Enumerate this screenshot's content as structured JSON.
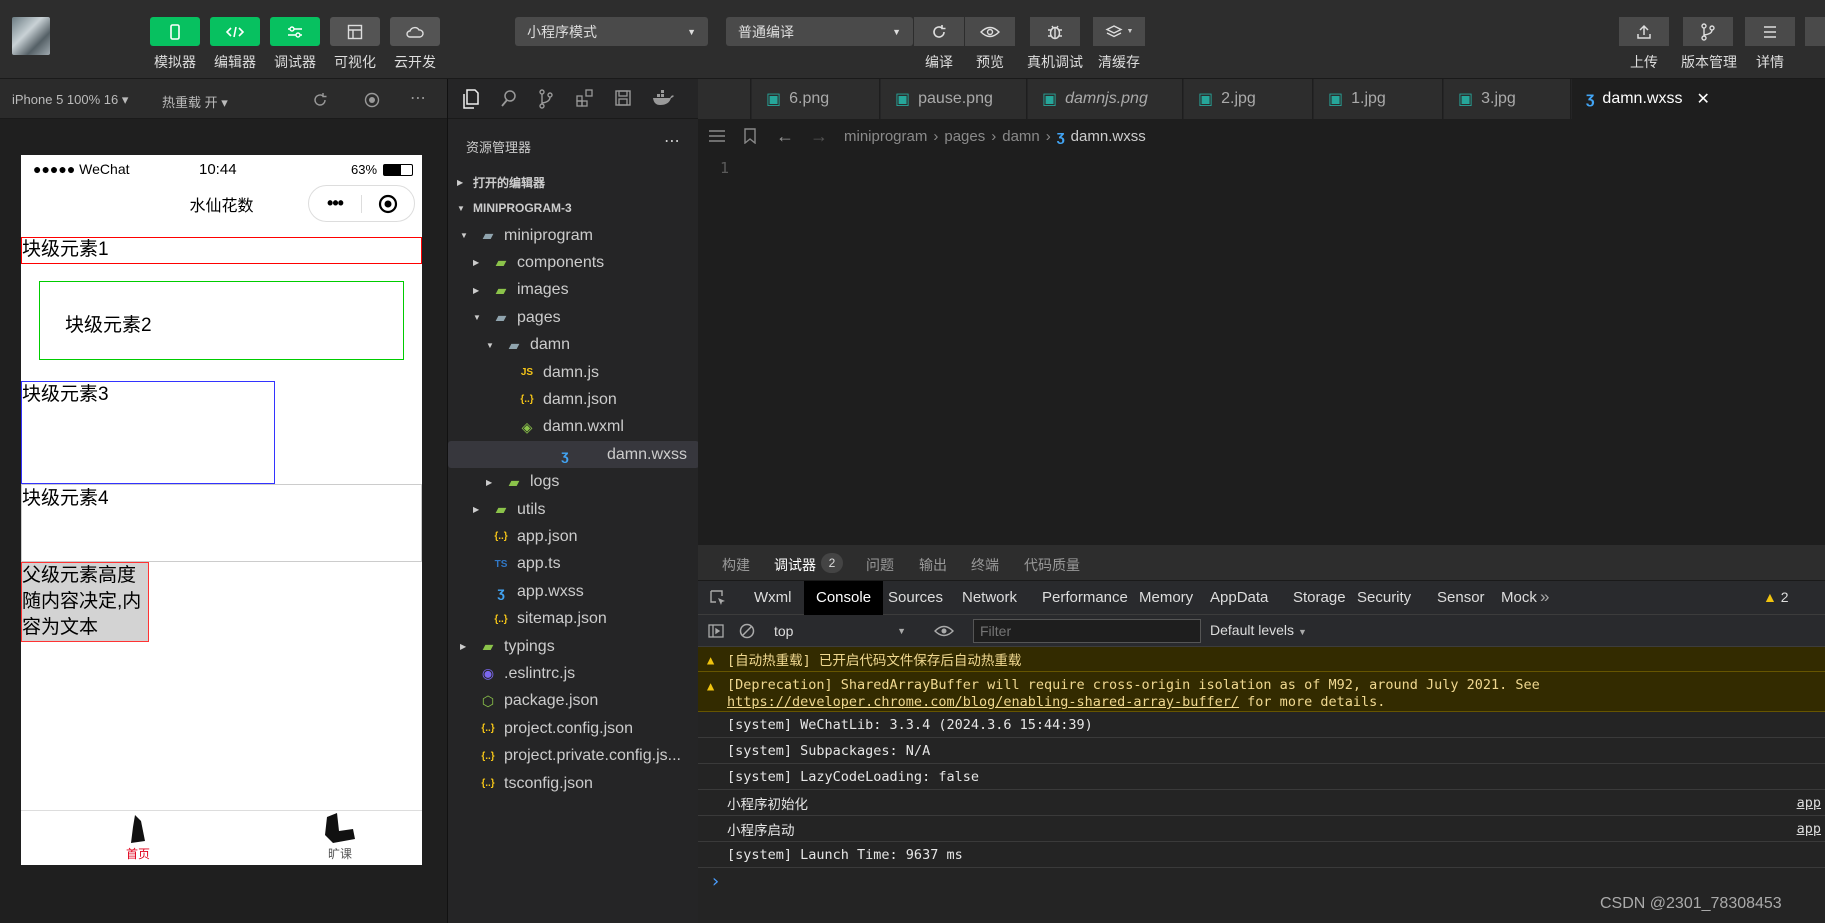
{
  "toolbar": {
    "buttons": [
      {
        "label": "模拟器",
        "icon": "phone-icon"
      },
      {
        "label": "编辑器",
        "icon": "code-icon"
      },
      {
        "label": "调试器",
        "icon": "debug-icon"
      },
      {
        "label": "可视化",
        "icon": "layout-icon"
      },
      {
        "label": "云开发",
        "icon": "cloud-icon"
      }
    ],
    "mode_select": "小程序模式",
    "compile_select": "普通编译",
    "actions": [
      "编译",
      "预览",
      "真机调试",
      "清缓存"
    ],
    "right": [
      "上传",
      "版本管理",
      "详情"
    ]
  },
  "sim": {
    "device": "iPhone 5 100% 16",
    "hotreload": "热重载 开",
    "status_carrier": "●●●●● WeChat",
    "status_time": "10:44",
    "status_battery": "63%",
    "nav_title": "水仙花数",
    "blocks": [
      "块级元素1",
      "块级元素2",
      "块级元素3",
      "块级元素4"
    ],
    "parent_block": "父级元素高度随内容决定,内容为文本",
    "tabbar": [
      "首页",
      "旷课"
    ],
    "colors": {
      "block1": "#ff0000",
      "block2": "#00cc00",
      "block3": "#3333ff",
      "parent": "#ff3333",
      "parent_bg": "#d3d3d3"
    }
  },
  "explorer": {
    "title": "资源管理器",
    "open_editors": "打开的编辑器",
    "project": "MINIPROGRAM-3",
    "tree": [
      {
        "name": "miniprogram",
        "icon": "folder-open-icon",
        "level": 1,
        "arrow": "down"
      },
      {
        "name": "components",
        "icon": "folder-icon",
        "level": 2,
        "arrow": "right"
      },
      {
        "name": "images",
        "icon": "folder-icon",
        "level": 2,
        "arrow": "right"
      },
      {
        "name": "pages",
        "icon": "folder-open-icon",
        "level": 2,
        "arrow": "down"
      },
      {
        "name": "damn",
        "icon": "folder-open-icon",
        "level": 3,
        "arrow": "down"
      },
      {
        "name": "damn.js",
        "icon": "js-file-icon",
        "level": 4,
        "arrow": ""
      },
      {
        "name": "damn.json",
        "icon": "json-file-icon",
        "level": 4,
        "arrow": ""
      },
      {
        "name": "damn.wxml",
        "icon": "wxml-file-icon",
        "level": 4,
        "arrow": ""
      },
      {
        "name": "damn.wxss",
        "icon": "css-file-icon",
        "level": 4,
        "arrow": ""
      },
      {
        "name": "logs",
        "icon": "folder-icon",
        "level": 3,
        "arrow": "right"
      },
      {
        "name": "utils",
        "icon": "folder-icon",
        "level": 2,
        "arrow": "right"
      },
      {
        "name": "app.json",
        "icon": "json-file-icon",
        "level": 2,
        "arrow": ""
      },
      {
        "name": "app.ts",
        "icon": "ts-file-icon",
        "level": 2,
        "arrow": ""
      },
      {
        "name": "app.wxss",
        "icon": "css-file-icon",
        "level": 2,
        "arrow": ""
      },
      {
        "name": "sitemap.json",
        "icon": "json-file-icon",
        "level": 2,
        "arrow": ""
      },
      {
        "name": "typings",
        "icon": "folder-icon",
        "level": 1,
        "arrow": "right"
      },
      {
        "name": ".eslintrc.js",
        "icon": "eslint-file-icon",
        "level": 1,
        "arrow": ""
      },
      {
        "name": "package.json",
        "icon": "node-file-icon",
        "level": 1,
        "arrow": ""
      },
      {
        "name": "project.config.json",
        "icon": "json-file-icon",
        "level": 1,
        "arrow": ""
      },
      {
        "name": "project.private.config.js...",
        "icon": "json-file-icon",
        "level": 1,
        "arrow": ""
      },
      {
        "name": "tsconfig.json",
        "icon": "json-file-icon",
        "level": 1,
        "arrow": ""
      }
    ]
  },
  "editor": {
    "tabs": [
      "6.png",
      "pause.png",
      "damnjs.png",
      "2.jpg",
      "1.jpg",
      "3.jpg",
      "damn.wxss"
    ],
    "breadcrumb": [
      "miniprogram",
      "pages",
      "damn",
      "damn.wxss"
    ],
    "line_number": "1"
  },
  "devtools": {
    "top_tabs": [
      "构建",
      "调试器",
      "问题",
      "输出",
      "终端",
      "代码质量"
    ],
    "debugger_badge": "2",
    "tabs": [
      "Wxml",
      "Console",
      "Sources",
      "Network",
      "Performance",
      "Memory",
      "AppData",
      "Storage",
      "Security",
      "Sensor",
      "Mock"
    ],
    "active_tab": "Console",
    "warn_count": "2",
    "context": "top",
    "filter_placeholder": "Filter",
    "levels": "Default levels",
    "console_lines": [
      {
        "type": "warn",
        "text": "[自动热重载] 已开启代码文件保存后自动热重载",
        "link": "",
        "suffix": "",
        "source": ""
      },
      {
        "type": "warn",
        "text": "[Deprecation] SharedArrayBuffer will require cross-origin isolation as of M92, around July 2021. See ",
        "link": "https://developer.chrome.com/blog/enabling-shared-array-buffer/",
        "suffix": " for more details.",
        "source": ""
      },
      {
        "type": "log",
        "text": "[system] WeChatLib: 3.3.4 (2024.3.6 15:44:39)",
        "link": "",
        "suffix": "",
        "source": ""
      },
      {
        "type": "log",
        "text": "[system] Subpackages: N/A",
        "link": "",
        "suffix": "",
        "source": ""
      },
      {
        "type": "log",
        "text": "[system] LazyCodeLoading: false",
        "link": "",
        "suffix": "",
        "source": ""
      },
      {
        "type": "log",
        "text": "小程序初始化",
        "link": "",
        "suffix": "",
        "source": "app"
      },
      {
        "type": "log",
        "text": "小程序启动",
        "link": "",
        "suffix": "",
        "source": "app"
      },
      {
        "type": "log",
        "text": "[system] Launch Time: 9637 ms",
        "link": "",
        "suffix": "",
        "source": ""
      }
    ],
    "prompt": "›"
  },
  "watermark": "CSDN @2301_78308453"
}
